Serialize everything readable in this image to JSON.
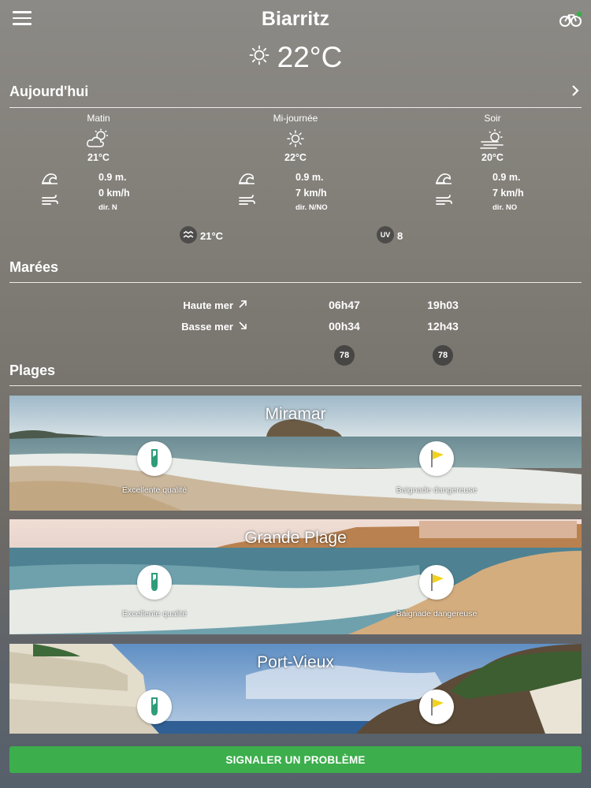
{
  "header": {
    "title": "Biarritz",
    "current_temp": "22°C"
  },
  "today": {
    "title": "Aujourd'hui",
    "periods": [
      {
        "label": "Matin",
        "icon": "partly-cloudy-icon",
        "temp": "21°C",
        "wave": "0.9 m.",
        "wind": "0 km/h",
        "dir": "dir. N"
      },
      {
        "label": "Mi-journée",
        "icon": "sun-icon",
        "temp": "22°C",
        "wave": "0.9 m.",
        "wind": "7 km/h",
        "dir": "dir. N/NO"
      },
      {
        "label": "Soir",
        "icon": "sun-haze-icon",
        "temp": "20°C",
        "wave": "0.9 m.",
        "wind": "7 km/h",
        "dir": "dir. NO"
      }
    ],
    "water_temp": "21°C",
    "uv_label": "UV",
    "uv_index": "8"
  },
  "tides": {
    "title": "Marées",
    "high_label": "Haute mer",
    "low_label": "Basse mer",
    "high_times": [
      "06h47",
      "19h03"
    ],
    "low_times": [
      "00h34",
      "12h43"
    ],
    "coefficients": [
      "78",
      "78"
    ]
  },
  "beaches": {
    "title": "Plages",
    "items": [
      {
        "name": "Miramar",
        "quality": "Excellente qualité",
        "safety": "Baignade dangereuse"
      },
      {
        "name": "Grande Plage",
        "quality": "Excellente qualité",
        "safety": "Baignade dangereuse"
      },
      {
        "name": "Port-Vieux",
        "quality": "",
        "safety": ""
      }
    ]
  },
  "actions": {
    "report_label": "SIGNALER UN PROBLÈME"
  },
  "colors": {
    "accent_green": "#3cae4c",
    "quality_green": "#2e9b7a",
    "flag_yellow": "#f2d21b"
  }
}
